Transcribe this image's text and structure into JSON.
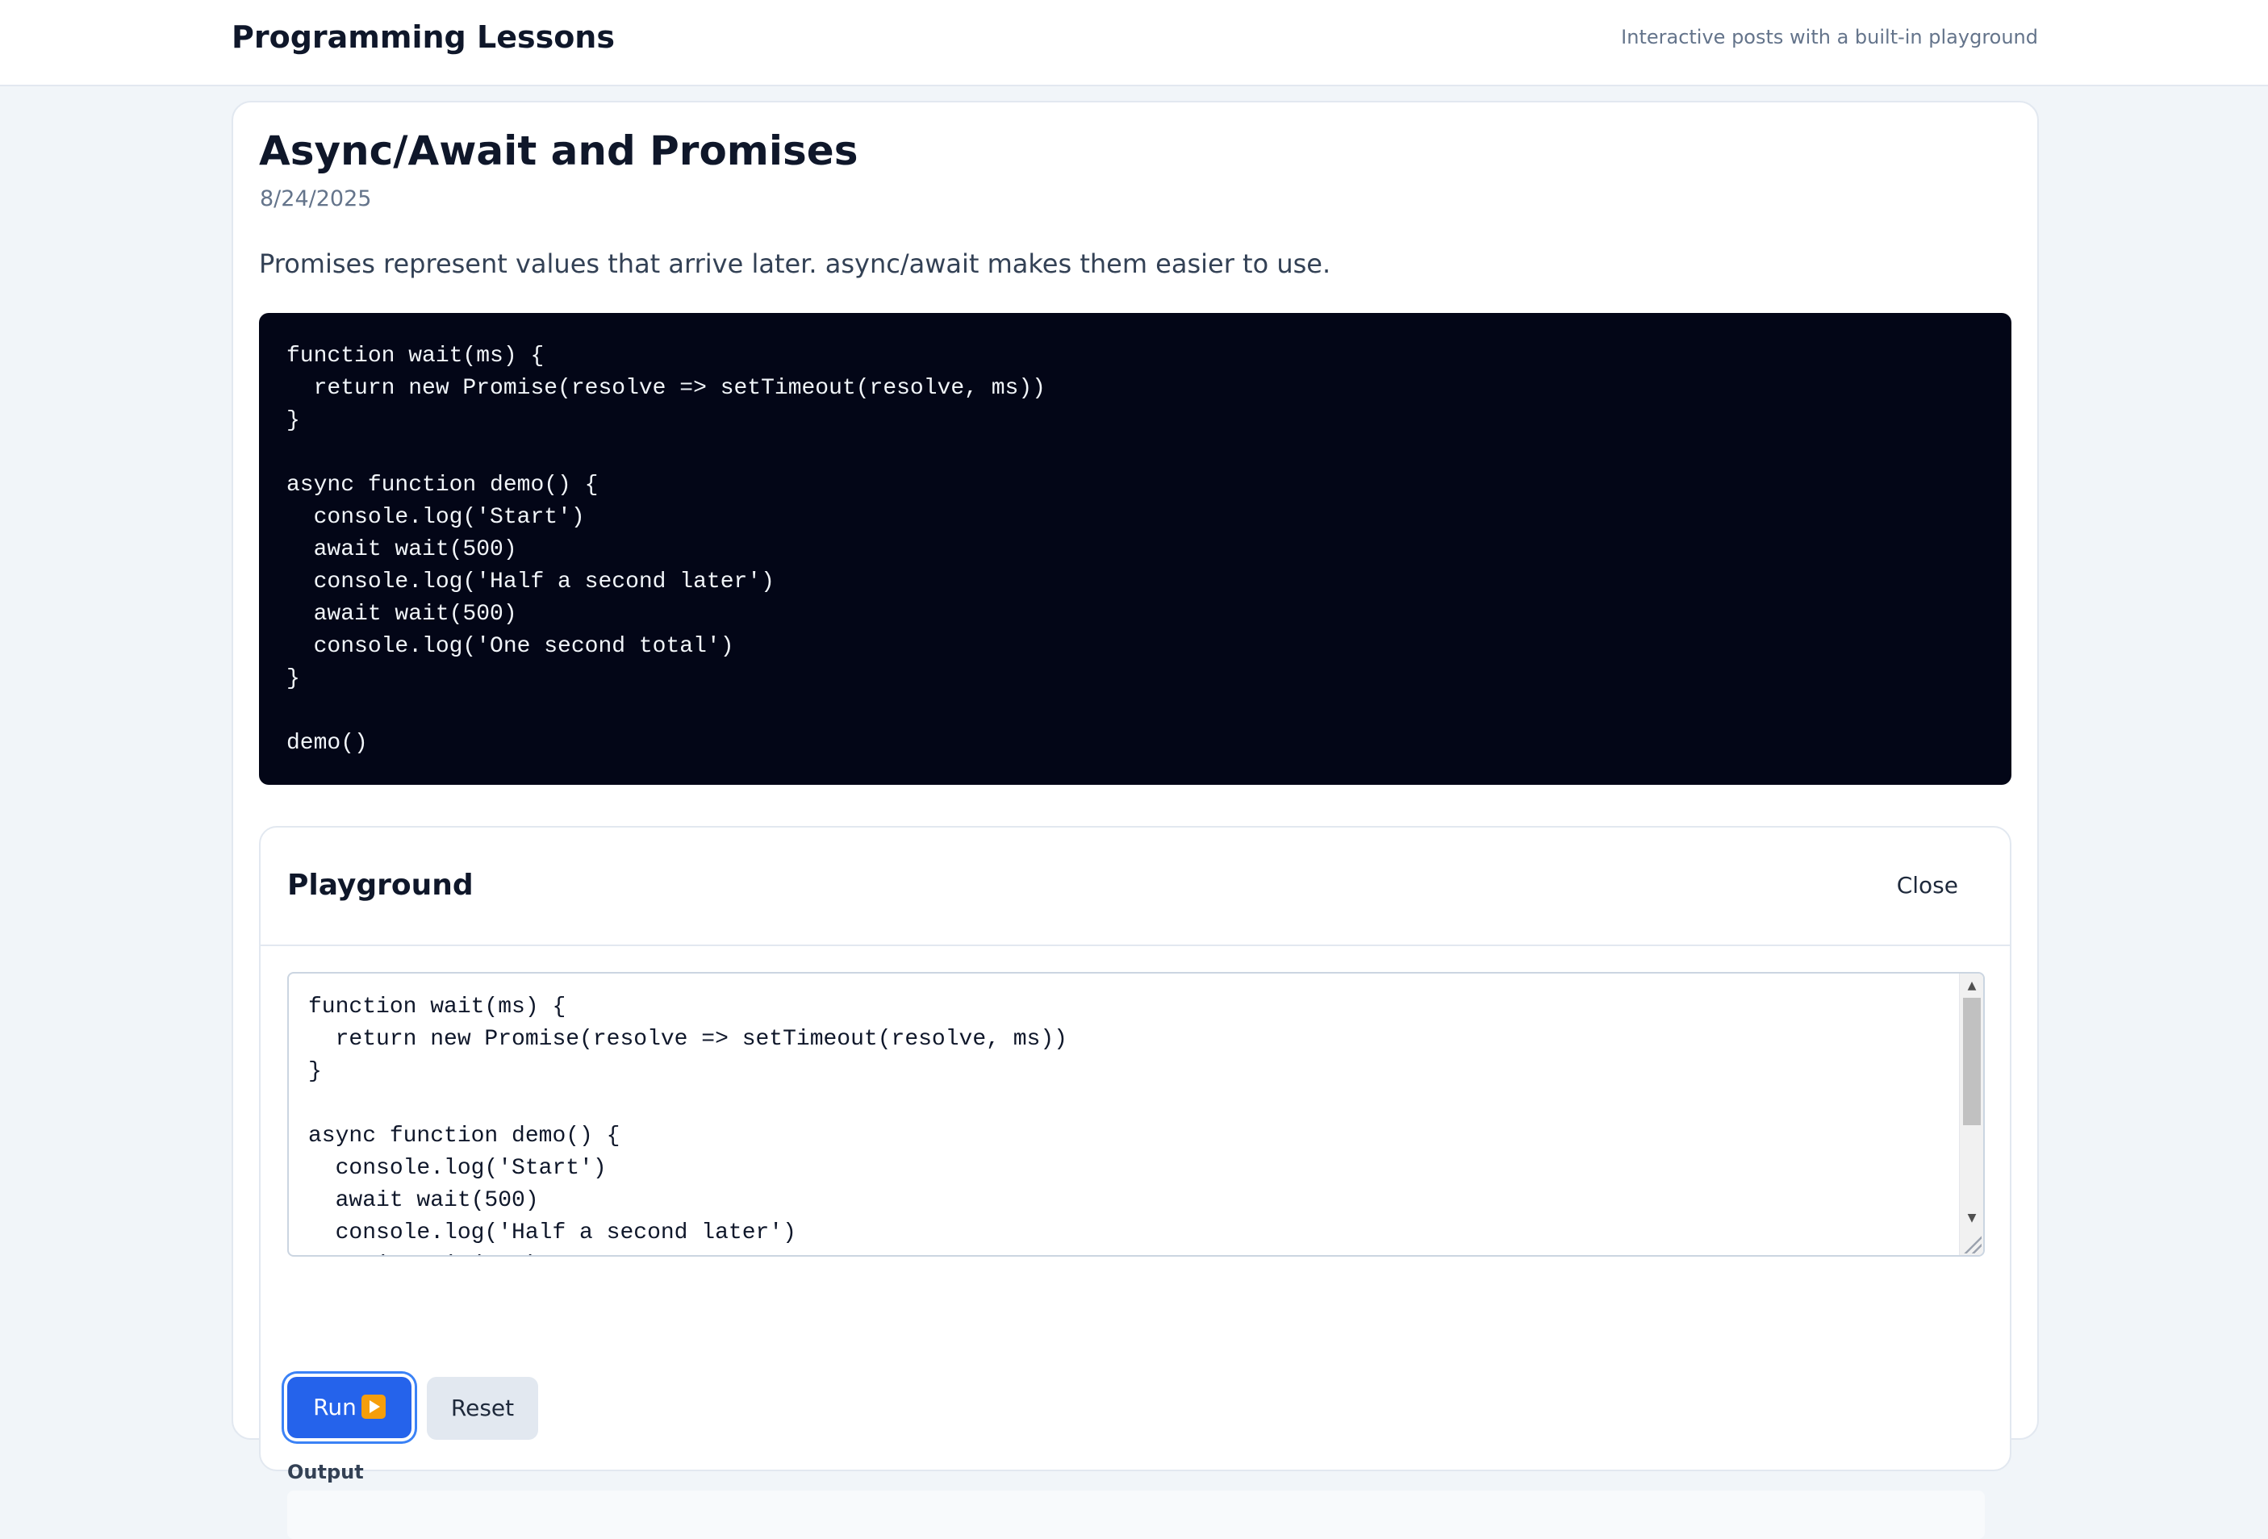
{
  "header": {
    "site_title": "Programming Lessons",
    "tagline": "Interactive posts with a built-in playground"
  },
  "post": {
    "title": "Async/Await and Promises",
    "date": "8/24/2025",
    "intro": "Promises represent values that arrive later. async/await makes them easier to use.",
    "code": "function wait(ms) {\n  return new Promise(resolve => setTimeout(resolve, ms))\n}\n\nasync function demo() {\n  console.log('Start')\n  await wait(500)\n  console.log('Half a second later')\n  await wait(500)\n  console.log('One second total')\n}\n\ndemo()"
  },
  "playground": {
    "title": "Playground",
    "close_label": "Close",
    "editor_value": "function wait(ms) {\n  return new Promise(resolve => setTimeout(resolve, ms))\n}\n\nasync function demo() {\n  console.log('Start')\n  await wait(500)\n  console.log('Half a second later')\n  await wait(500)\n  console.log('One second total')\n}\n\ndemo()",
    "run_label": "Run",
    "reset_label": "Reset",
    "output_label": "Output"
  },
  "icons": {
    "run": "play-icon",
    "scroll_up": "scroll-up-arrow-icon",
    "scroll_down": "scroll-down-arrow-icon",
    "resize": "resize-grip-icon"
  },
  "colors": {
    "accent": "#2563eb",
    "code_bg": "#030617",
    "page_bg": "#f1f5f9"
  }
}
